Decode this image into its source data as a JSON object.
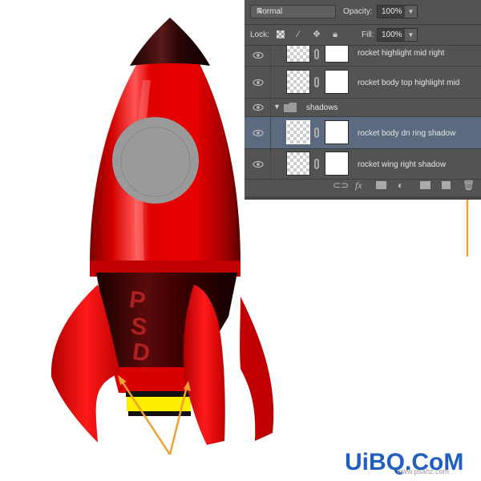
{
  "layers_panel": {
    "blend_mode": "Normal",
    "opacity_label": "Opacity:",
    "opacity_value": "100%",
    "lock_label": "Lock:",
    "fill_label": "Fill:",
    "fill_value": "100%",
    "layers": [
      {
        "name": "rocket highlight mid right",
        "type": "layer",
        "visible": true,
        "selected": false
      },
      {
        "name": "rocket body top highlight mid",
        "type": "layer",
        "visible": true,
        "selected": false
      },
      {
        "name": "shadows",
        "type": "group",
        "visible": true,
        "expanded": true
      },
      {
        "name": "rocket body dn ring shadow",
        "type": "layer",
        "visible": true,
        "selected": true
      },
      {
        "name": "rocket wing right shadow",
        "type": "layer",
        "visible": true,
        "selected": false
      }
    ],
    "footer_icons": [
      "link-icon",
      "fx-icon",
      "mask-icon",
      "adjustment-icon",
      "folder-icon",
      "new-layer-icon",
      "trash-icon"
    ],
    "fx_label": "fx"
  },
  "artwork": {
    "rocket_text": [
      "P",
      "S",
      "D"
    ],
    "colors": {
      "body_red": "#e00000",
      "nose_dark": "#2a0505",
      "window_gray": "#9a9a9a",
      "flame_yellow": "#ffee00",
      "arrow_orange": "#f0a030"
    }
  },
  "watermark": {
    "text": "UiBQ.CoM",
    "url": "www.psahz.com"
  },
  "colors": {
    "panel_bg": "#535353",
    "selected_row": "#5b6a7e",
    "accent_arrow": "#f0a030"
  }
}
